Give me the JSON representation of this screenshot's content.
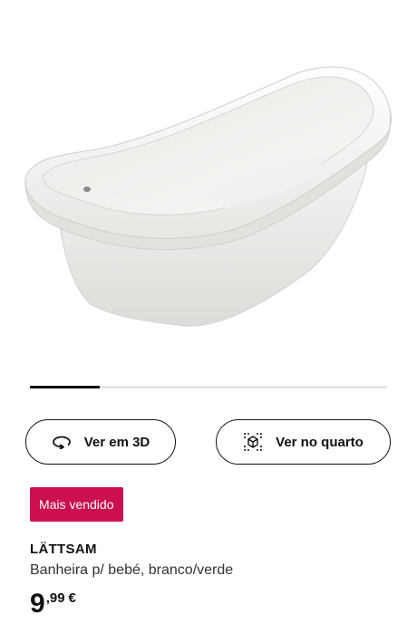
{
  "gallery": {
    "image_alt": "Banheira p/ bebé, branco/verde",
    "progress_fraction": 0.195
  },
  "actions": {
    "view_3d_label": "Ver em 3D",
    "view_in_room_label": "Ver no quarto"
  },
  "badge": {
    "label": "Mais vendido",
    "color": "#cc0f4f"
  },
  "product": {
    "name": "LÄTTSAM",
    "description": "Banheira p/ bebé, branco/verde",
    "price_integer": "9",
    "price_decimal": ",99",
    "price_currency": "€"
  }
}
